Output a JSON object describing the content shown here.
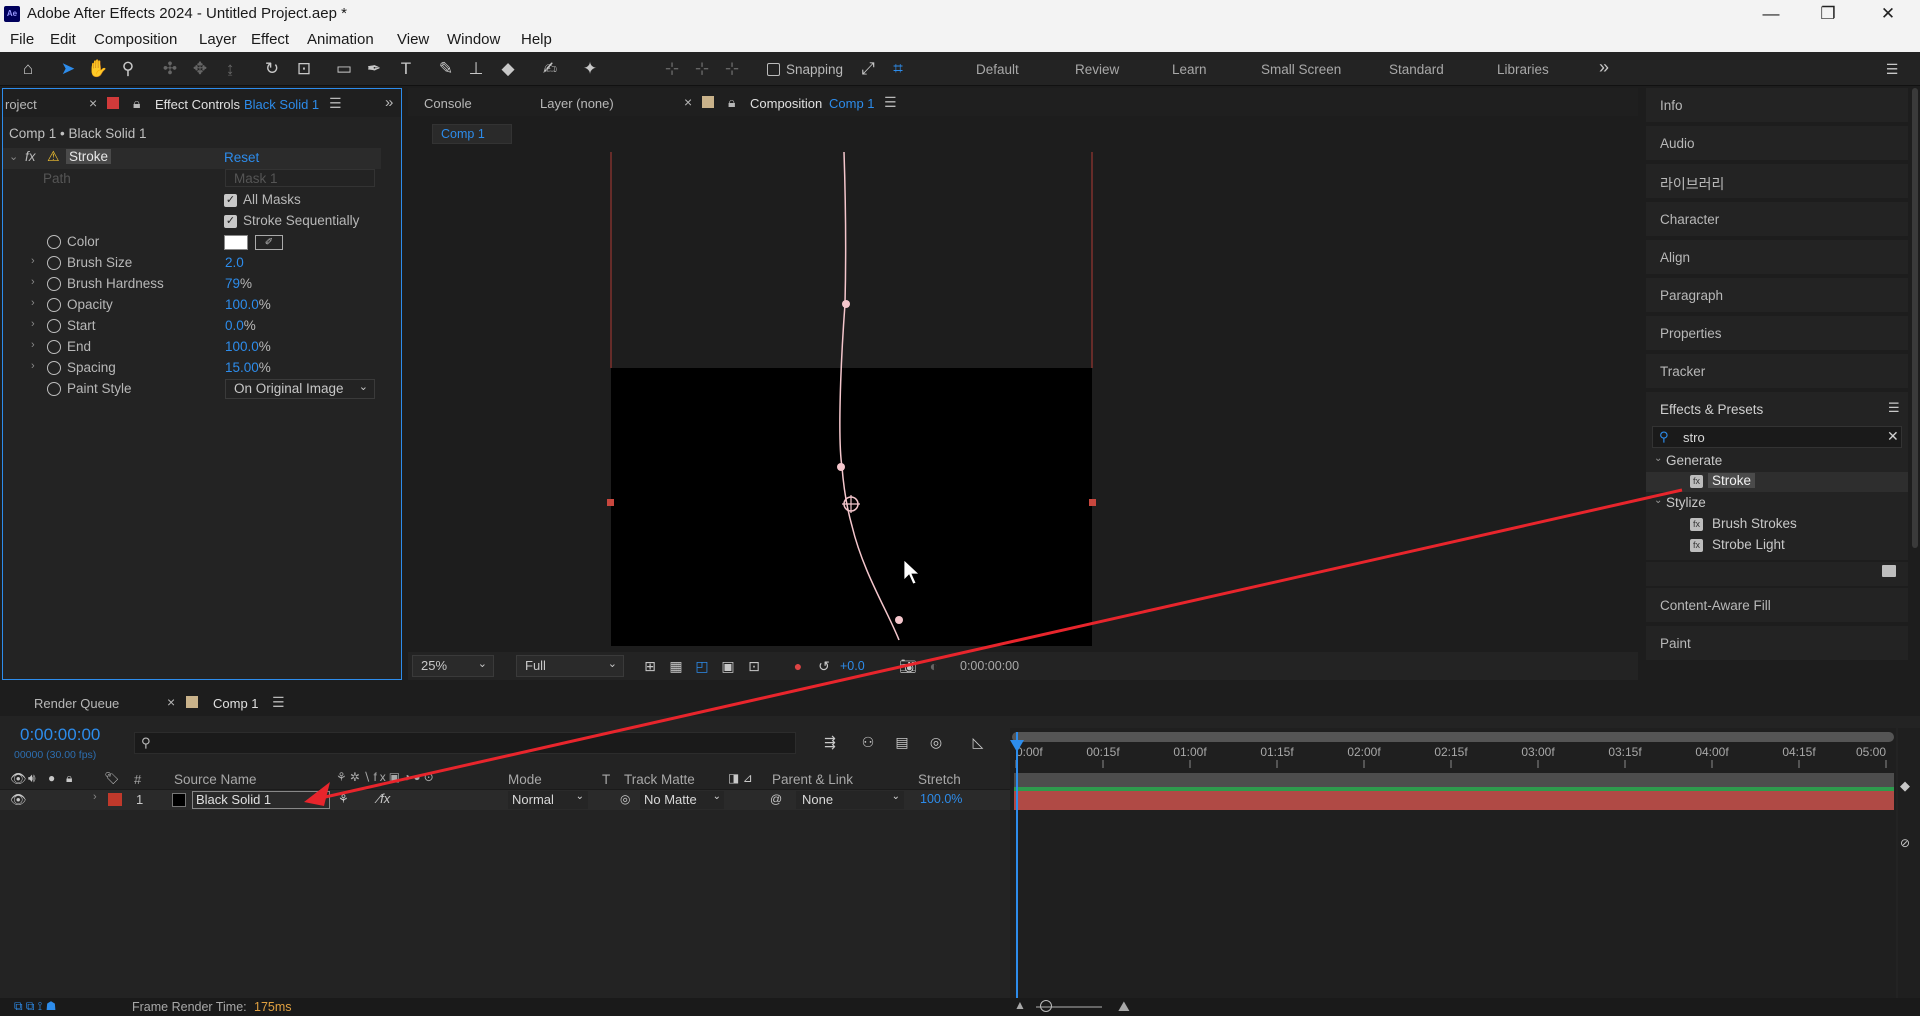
{
  "window": {
    "title": "Adobe After Effects 2024 - Untitled Project.aep *",
    "logo_text": "Ae",
    "minimize": "—",
    "maximize": "❐",
    "close": "✕"
  },
  "menu": [
    "File",
    "Edit",
    "Composition",
    "Layer",
    "Effect",
    "Animation",
    "View",
    "Window",
    "Help"
  ],
  "toolbar": {
    "snapping_label": "Snapping",
    "workspaces": [
      "Default",
      "Review",
      "Learn",
      "Small Screen",
      "Standard",
      "Libraries"
    ],
    "more": "»"
  },
  "effect_controls": {
    "project_tab": "roject",
    "tab_label": "Effect Controls",
    "tab_layer": "Black Solid 1",
    "header": "Comp 1 • Black Solid 1",
    "effect_name": "Stroke",
    "reset_label": "Reset",
    "path_label": "Path",
    "path_value": "Mask 1",
    "all_masks_label": "All Masks",
    "stroke_seq_label": "Stroke Sequentially",
    "properties": [
      {
        "label": "Color",
        "value": "",
        "unit": ""
      },
      {
        "label": "Brush Size",
        "value": "2.0",
        "unit": ""
      },
      {
        "label": "Brush Hardness",
        "value": "79",
        "unit": "%"
      },
      {
        "label": "Opacity",
        "value": "100.0",
        "unit": "%"
      },
      {
        "label": "Start",
        "value": "0.0",
        "unit": "%"
      },
      {
        "label": "End",
        "value": "100.0",
        "unit": "%"
      },
      {
        "label": "Spacing",
        "value": "15.00",
        "unit": "%"
      }
    ],
    "paint_style_label": "Paint Style",
    "paint_style_value": "On Original Image"
  },
  "viewer": {
    "tabs": {
      "console": "Console",
      "layer": "Layer (none)",
      "composition": "Composition",
      "comp_name": "Comp 1"
    },
    "breadcrumb": "Comp 1",
    "zoom": "25%",
    "resolution": "Full",
    "exposure": "+0.0",
    "timecode": "0:00:00:00"
  },
  "right_panels": {
    "items_top": [
      "Info",
      "Audio",
      "라이브러리",
      "Character",
      "Align",
      "Paragraph",
      "Properties",
      "Tracker"
    ],
    "effects_presets_title": "Effects & Presets",
    "search_value": "stro",
    "tree": [
      {
        "group": "Generate",
        "items": [
          "Stroke"
        ]
      },
      {
        "group": "Stylize",
        "items": [
          "Brush Strokes",
          "Strobe Light"
        ]
      }
    ],
    "items_bottom": [
      "Content-Aware Fill",
      "Paint"
    ]
  },
  "timeline": {
    "render_queue_tab": "Render Queue",
    "comp_tab": "Comp 1",
    "current_time": "0:00:00:00",
    "fps": "00000 (30.00 fps)",
    "columns": {
      "hash": "#",
      "source_name": "Source Name",
      "mode": "Mode",
      "t": "T",
      "track_matte": "Track Matte",
      "parent_link": "Parent & Link",
      "stretch": "Stretch"
    },
    "layer": {
      "index": "1",
      "name": "Black Solid 1",
      "mode": "Normal",
      "track_matte": "No Matte",
      "parent": "None",
      "stretch": "100.0%"
    },
    "ruler": [
      "0:00f",
      "00:15f",
      "01:00f",
      "01:15f",
      "02:00f",
      "02:15f",
      "03:00f",
      "03:15f",
      "04:00f",
      "04:15f",
      "05:00"
    ]
  },
  "status": {
    "render_time_label": "Frame Render Time:",
    "render_time_value": "175ms"
  },
  "colors": {
    "accent": "#2d8ceb",
    "layer_label_red": "#c0392b",
    "annotation_arrow": "#e8252c"
  }
}
